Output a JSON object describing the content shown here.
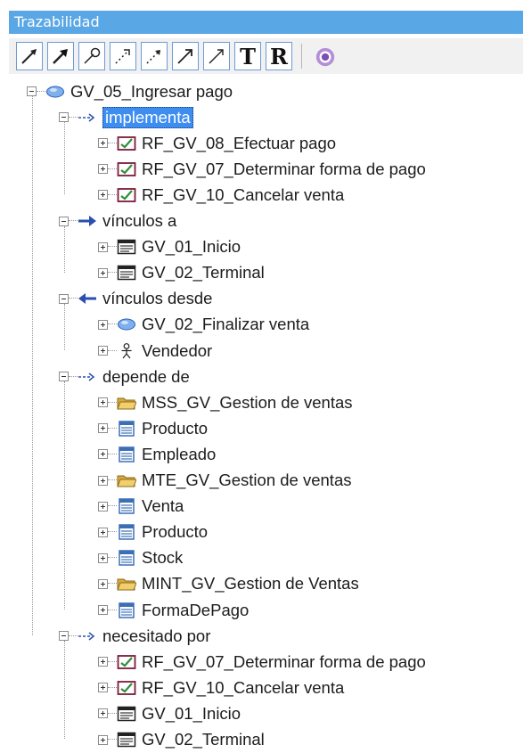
{
  "panel": {
    "title": "Trazabilidad",
    "toolbar": [
      "arrow-tool-1",
      "arrow-tool-2",
      "pin-tool",
      "dotted-arrow-tool-1",
      "dotted-arrow-tool-2",
      "arrow-tool-3",
      "arrow-tool-4"
    ],
    "letter_buttons": [
      "T",
      "R"
    ]
  },
  "tree": {
    "root": {
      "label": "GV_05_Ingresar pago",
      "icon": "usecase-icon"
    },
    "groups": [
      {
        "label": "implementa",
        "icon": "dashed-arrow-icon",
        "selected": true,
        "items": [
          {
            "label": "RF_GV_08_Efectuar pago",
            "icon": "requirement-icon"
          },
          {
            "label": "RF_GV_07_Determinar forma de pago",
            "icon": "requirement-icon"
          },
          {
            "label": "RF_GV_10_Cancelar venta",
            "icon": "requirement-icon"
          }
        ]
      },
      {
        "label": "vínculos a",
        "icon": "arrow-right-icon",
        "items": [
          {
            "label": "GV_01_Inicio",
            "icon": "screen-icon"
          },
          {
            "label": "GV_02_Terminal",
            "icon": "screen-icon"
          }
        ]
      },
      {
        "label": "vínculos desde",
        "icon": "arrow-left-icon",
        "items": [
          {
            "label": "GV_02_Finalizar venta",
            "icon": "usecase-icon"
          },
          {
            "label": "Vendedor",
            "icon": "actor-icon"
          }
        ]
      },
      {
        "label": "depende de",
        "icon": "dashed-arrow-icon",
        "items": [
          {
            "label": "MSS_GV_Gestion de ventas",
            "icon": "folder-icon"
          },
          {
            "label": "Producto",
            "icon": "class-icon"
          },
          {
            "label": "Empleado",
            "icon": "class-icon"
          },
          {
            "label": "MTE_GV_Gestion de ventas",
            "icon": "folder-icon"
          },
          {
            "label": "Venta",
            "icon": "class-icon"
          },
          {
            "label": "Producto",
            "icon": "class-icon"
          },
          {
            "label": "Stock",
            "icon": "class-icon"
          },
          {
            "label": "MINT_GV_Gestion de Ventas",
            "icon": "folder-icon"
          },
          {
            "label": "FormaDePago",
            "icon": "class-icon"
          }
        ]
      },
      {
        "label": "necesitado por",
        "icon": "dashed-arrow-icon",
        "items": [
          {
            "label": "RF_GV_07_Determinar forma de pago",
            "icon": "requirement-icon"
          },
          {
            "label": "RF_GV_10_Cancelar venta",
            "icon": "requirement-icon"
          },
          {
            "label": "GV_01_Inicio",
            "icon": "screen-icon"
          },
          {
            "label": "GV_02_Terminal",
            "icon": "screen-icon"
          }
        ]
      }
    ]
  }
}
